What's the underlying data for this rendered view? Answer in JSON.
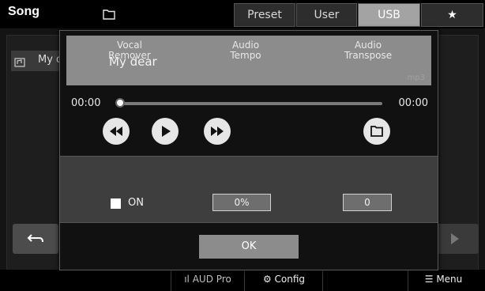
{
  "header": {
    "title": "Song",
    "tabs": [
      {
        "label": "Preset",
        "active": false
      },
      {
        "label": "User",
        "active": false
      },
      {
        "label": "USB",
        "active": true
      },
      {
        "label": "",
        "icon": "star-icon",
        "active": false
      }
    ]
  },
  "background_list": {
    "item_label": "My d",
    "item_icon": "audio-file-icon"
  },
  "player_dialog": {
    "song_name": "My dear",
    "file_type": "mp3",
    "time_start": "00:00",
    "time_end": "00:00",
    "progress": 0,
    "controls": [
      "rewind-icon",
      "play-icon",
      "fast-forward-icon",
      "folder-icon"
    ],
    "settings": {
      "vocal_remover": {
        "label_line1": "Vocal",
        "label_line2": "Remover",
        "state": "ON"
      },
      "audio_tempo": {
        "label_line1": "Audio",
        "label_line2": "Tempo",
        "value": "0%"
      },
      "audio_transpose": {
        "label_line1": "Audio",
        "label_line2": "Transpose",
        "value": "0"
      }
    },
    "ok_label": "OK"
  },
  "bottom_bar": {
    "aud_pro": "AUD Pro",
    "config": "Config",
    "menu": "Menu"
  },
  "colors": {
    "accent_tab": "#a3a3a3",
    "dialog_bg": "#111111",
    "display_bg": "#8c8c8c"
  }
}
